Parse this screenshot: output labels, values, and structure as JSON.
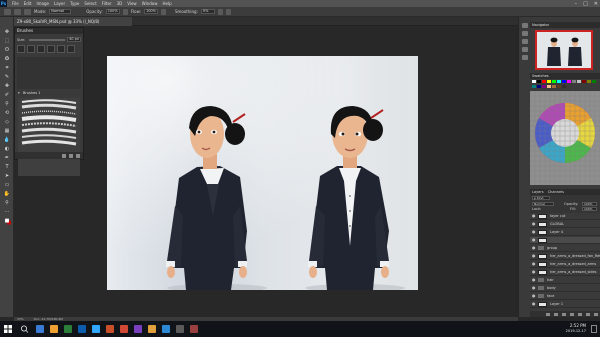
{
  "app": {
    "logo_text": "Ps"
  },
  "menu": [
    "File",
    "Edit",
    "Image",
    "Layer",
    "Type",
    "Select",
    "Filter",
    "3D",
    "View",
    "Window",
    "Help"
  ],
  "window_controls": [
    "–",
    "□",
    "✕"
  ],
  "options_bar": {
    "mode_label": "Mode:",
    "mode_value": "Normal",
    "opacity_label": "Opacity:",
    "opacity_value": "100%",
    "flow_label": "Flow:",
    "flow_value": "100%",
    "smoothing_label": "Smoothing:",
    "smoothing_value": "0%"
  },
  "document_tab": {
    "title": "Z9-x80_SkalVR_MSN.psd @ 33% (l_NQ/8)"
  },
  "brush_panel": {
    "title": "Brushes",
    "size_label": "Size:",
    "size_value": "40 px",
    "group_label": "Brushes 1"
  },
  "right_panels": {
    "navigator_title": "Navigator",
    "swatches_title": "Swatches",
    "layers_tab": "Layers",
    "channels_tab": "Channels",
    "kind_label": "ρ Kind",
    "blend_value": "Normal",
    "opacity_label": "Opacity:",
    "opacity_value": "100%",
    "lock_label": "Lock:",
    "fill_label": "Fill:",
    "fill_value": "100%"
  },
  "swatch_colors": [
    "#ffffff",
    "#000000",
    "#ff0000",
    "#ffff00",
    "#00ff00",
    "#00ffff",
    "#0000ff",
    "#ff00ff",
    "#7f7f7f",
    "#c0c0c0",
    "#800000",
    "#808000",
    "#008000",
    "#008080",
    "#000080",
    "#800080",
    "#f7c08a",
    "#a56b3a",
    "#5a3a22",
    "#2e2e2e"
  ],
  "layers": [
    {
      "name": "layer cut",
      "type": "layer",
      "selected": false
    },
    {
      "name": "GLOBAL",
      "type": "layer",
      "selected": false
    },
    {
      "name": "Layer 4",
      "type": "layer",
      "selected": false
    },
    {
      "name": "",
      "type": "layer",
      "selected": true
    },
    {
      "name": "group",
      "type": "group",
      "selected": false
    },
    {
      "name": "her_arms_a_dressed_fan_Ref",
      "type": "layer",
      "selected": false
    },
    {
      "name": "her_arms_a_dressed_arms",
      "type": "layer",
      "selected": false
    },
    {
      "name": "her_arms_a_dressed_sides",
      "type": "layer",
      "selected": false
    },
    {
      "name": "hair",
      "type": "group",
      "selected": false
    },
    {
      "name": "body",
      "type": "group",
      "selected": false
    },
    {
      "name": "face",
      "type": "group",
      "selected": false
    },
    {
      "name": "Layer 1",
      "type": "layer",
      "selected": false
    }
  ],
  "status_bar": {
    "zoom": "33%",
    "doc": "Doc: 24.7M/180.9M"
  },
  "taskbar": {
    "clock_time": "2:52 PM",
    "clock_date": "2019-12-17",
    "app_icon_colors": [
      "#3a7bd5",
      "#f0a030",
      "#2d7d3a",
      "#0b5cad",
      "#31a8ff",
      "#c94f2b",
      "#d14836",
      "#7a3fbf",
      "#e0a13c",
      "#2b89d6",
      "#5a5a5a",
      "#9a3f3f"
    ]
  },
  "icons": {
    "tools": [
      "move-icon",
      "marquee-icon",
      "lasso-icon",
      "quick-select-icon",
      "crop-icon",
      "eyedropper-icon",
      "healing-icon",
      "brush-icon",
      "clone-stamp-icon",
      "history-brush-icon",
      "eraser-icon",
      "gradient-icon",
      "blur-icon",
      "dodge-icon",
      "pen-icon",
      "type-icon",
      "path-select-icon",
      "rectangle-icon",
      "hand-icon",
      "zoom-icon",
      "edit-toolbar-icon",
      "fg-bg-color-icon"
    ],
    "tool_glyphs": [
      "✥",
      "⬚",
      "ʘ",
      "✪",
      "⌗",
      "✎",
      "✚",
      "✐",
      "⚲",
      "⟲",
      "◇",
      "▦",
      "💧",
      "◐",
      "✒",
      "T",
      "➤",
      "▭",
      "✋",
      "⚲",
      "⋯",
      "■"
    ]
  }
}
